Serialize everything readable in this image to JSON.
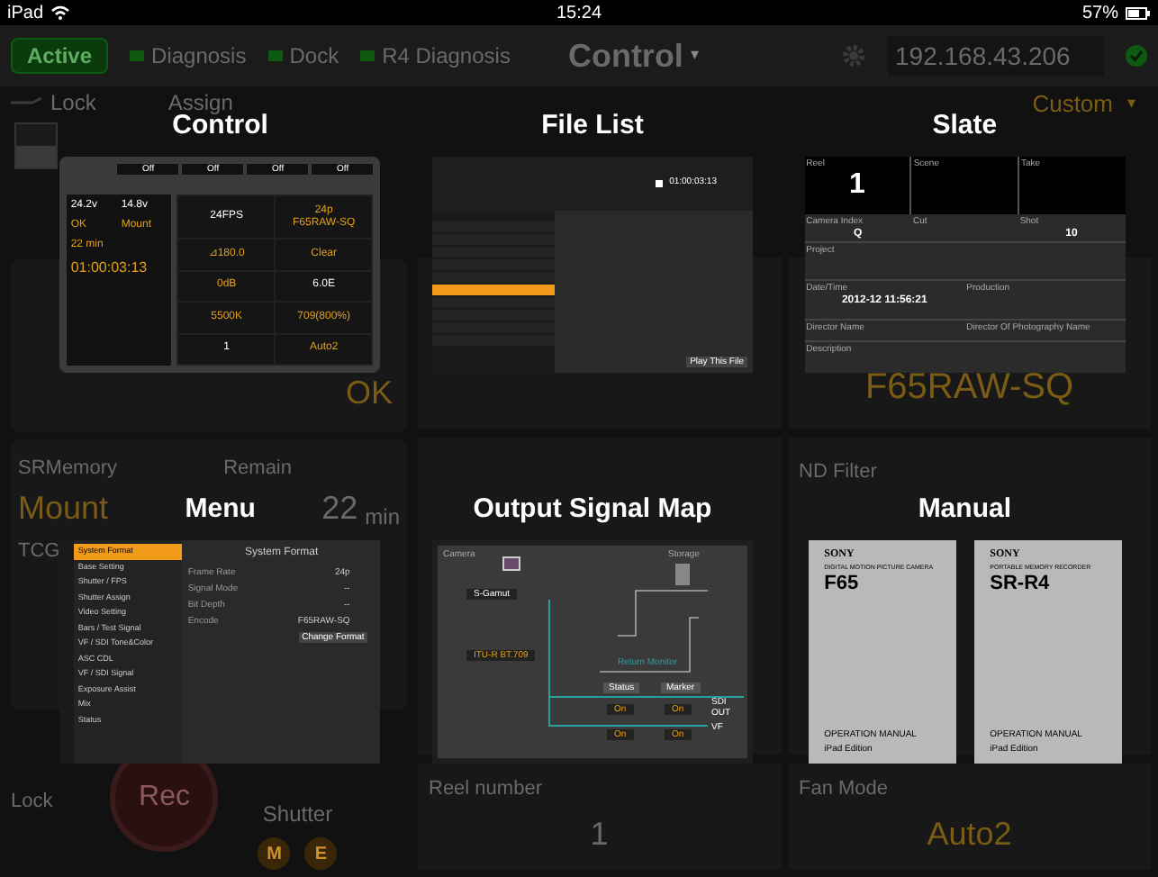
{
  "status_bar": {
    "device": "iPad",
    "time": "15:24",
    "battery": "57%"
  },
  "toolbar": {
    "active": "Active",
    "indicators": [
      {
        "label": "Diagnosis",
        "on": true
      },
      {
        "label": "Dock",
        "on": true
      },
      {
        "label": "R4 Diagnosis",
        "on": true
      }
    ],
    "title": "Control",
    "caret": "▾",
    "address": "192.168.43.206"
  },
  "background": {
    "lock": "Lock",
    "lock_switch": {
      "on": false
    },
    "assign": "Assign",
    "preset": "Custom",
    "caret": "▾",
    "ok": "OK",
    "sr_memory": "SRMemory",
    "remain": "Remain",
    "mount": "Mount",
    "remain_value": "22",
    "remain_unit": "min",
    "tcg": "TCG",
    "system_format": "F65RAW-SQ",
    "nd_filter": "ND Filter",
    "reel_number": "Reel number",
    "reel_value": "1",
    "fan_mode": "Fan Mode",
    "fan_value": "Auto2",
    "bottom_lock": "Lock",
    "rec": "Rec",
    "bottom_shutter": "Shutter",
    "shutter_buttons": [
      "M",
      "E"
    ]
  },
  "overlay": [
    {
      "kind": "control",
      "title": "Control",
      "assign": [
        "Off",
        "Off",
        "Off",
        "Off"
      ],
      "left_values": [
        "24.2v",
        "14.8v",
        "OK",
        "Mount",
        "22 min"
      ],
      "timecode": "01:00:03:13",
      "right_cells": [
        [
          "24FPS"
        ],
        [
          "24p",
          "F65RAW-SQ"
        ],
        [
          "⊿180.0"
        ],
        [
          "Clear"
        ],
        [
          "0dB"
        ],
        [
          "6.0E"
        ],
        [
          "5500K"
        ],
        [
          "709(800%)"
        ],
        [
          "1"
        ],
        [
          "Auto2"
        ]
      ]
    },
    {
      "kind": "file_list",
      "title": "File List",
      "timecode": "01:00:03:13",
      "files": [
        {
          "selected": false
        },
        {
          "selected": false
        },
        {
          "selected": false
        },
        {
          "selected": false
        },
        {
          "selected": false
        },
        {
          "selected": true
        },
        {
          "selected": false
        },
        {
          "selected": false
        },
        {
          "selected": false
        },
        {
          "selected": false
        }
      ],
      "play": "Play This File"
    },
    {
      "kind": "slate",
      "title": "Slate",
      "top": [
        {
          "label": "Reel",
          "value": "1"
        },
        {
          "label": "Scene"
        },
        {
          "label": "Take"
        }
      ],
      "mid": [
        {
          "label": "Camera Index",
          "value": "Q"
        },
        {
          "label": "Cut"
        },
        {
          "label": "Shot",
          "value": "10"
        }
      ],
      "project": "Project",
      "rows": [
        {
          "label": "Date/Time",
          "value": "2012-12 11:56:21"
        },
        {
          "label": "Production"
        },
        {
          "label": "Director Name"
        },
        {
          "label": "Director Of Photography Name"
        }
      ],
      "description": "Description"
    },
    {
      "kind": "menu",
      "title": "Menu",
      "items": [
        {
          "label": "System Format",
          "selected": true
        },
        {
          "label": "Base Setting",
          "selected": false
        },
        {
          "label": "Shutter / FPS",
          "selected": false
        },
        {
          "label": "Shutter Assign",
          "selected": false
        },
        {
          "label": "Video Setting",
          "selected": false
        },
        {
          "label": "Bars / Test Signal",
          "selected": false
        },
        {
          "label": "VF / SDI Tone&Color",
          "selected": false
        },
        {
          "label": "ASC CDL",
          "selected": false
        },
        {
          "label": "VF / SDI Signal",
          "selected": false
        },
        {
          "label": "Exposure Assist",
          "selected": false
        },
        {
          "label": "Mix",
          "selected": false
        },
        {
          "label": "Status",
          "selected": false
        }
      ],
      "heading": "System Format",
      "settings": [
        {
          "label": "Frame Rate",
          "value": "24p"
        },
        {
          "label": "Signal Mode",
          "value": "--"
        },
        {
          "label": "Bit Depth",
          "value": "--"
        },
        {
          "label": "Encode",
          "value": "F65RAW-SQ"
        }
      ],
      "button": "Change Format"
    },
    {
      "kind": "output_map",
      "title": "Output Signal Map",
      "camera": "Camera",
      "storage": "Storage",
      "color_space": "S-Gamut",
      "csel": "ITU-R BT.709",
      "return": "Return Monitor",
      "status": "Status",
      "marker": "Marker",
      "switches": [
        "On",
        "On",
        "On",
        "On"
      ],
      "outputs": [
        "SDI OUT",
        "VF"
      ]
    },
    {
      "kind": "manual",
      "title": "Manual",
      "books": [
        {
          "brand": "SONY",
          "subtitle": "DIGITAL MOTION PICTURE CAMERA",
          "model": "F65",
          "label": "OPERATION MANUAL",
          "edition": "iPad Edition"
        },
        {
          "brand": "SONY",
          "subtitle": "PORTABLE MEMORY RECORDER",
          "model": "SR-R4",
          "label": "OPERATION MANUAL",
          "edition": "iPad Edition"
        }
      ]
    }
  ]
}
